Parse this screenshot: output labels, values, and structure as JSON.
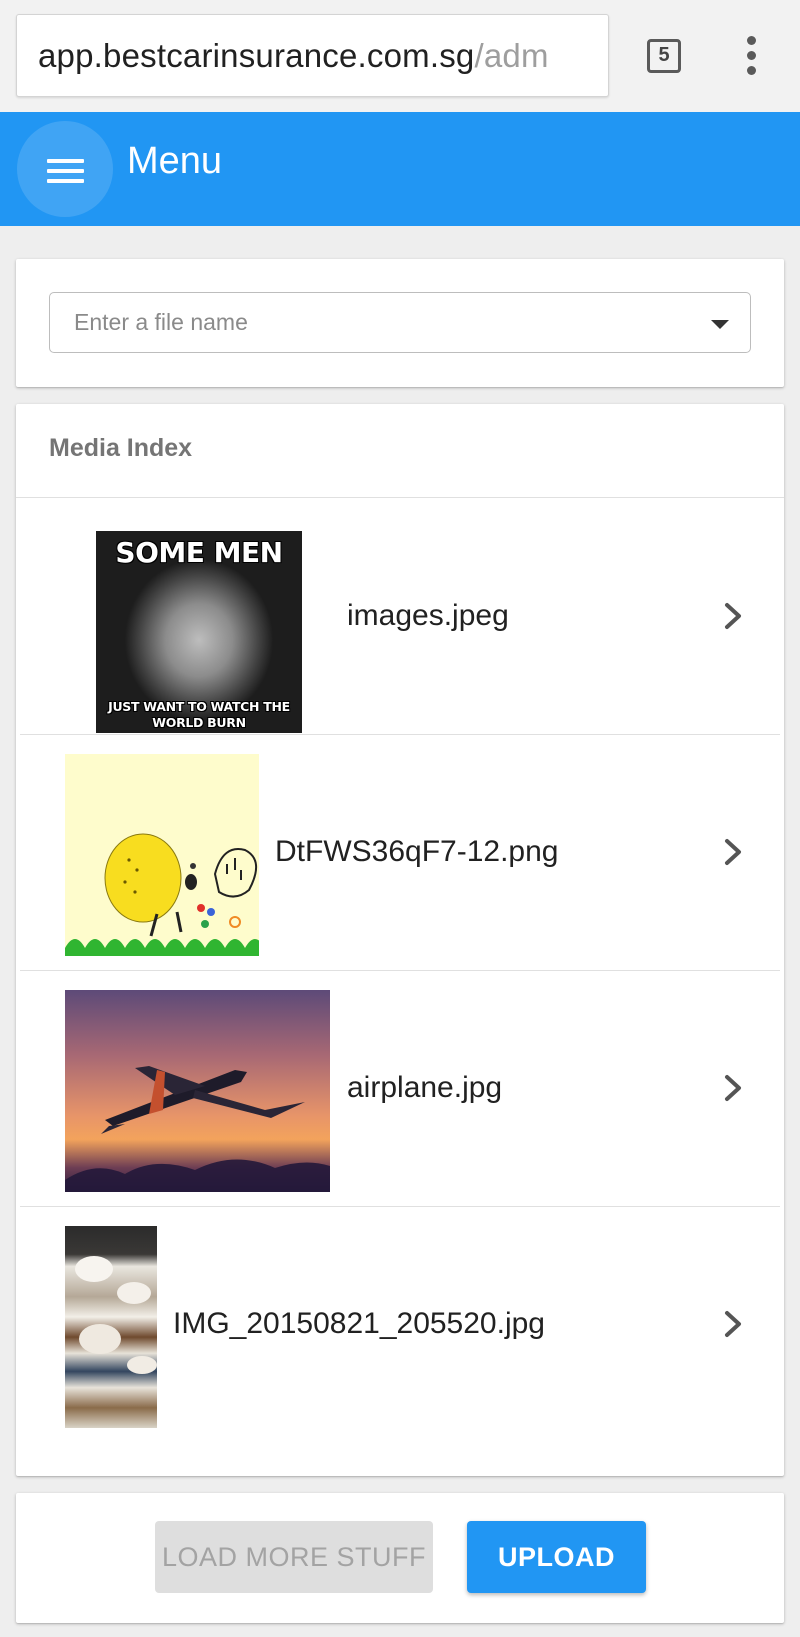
{
  "browser": {
    "url_host": "app.bestcarinsurance.com.sg",
    "url_path": "/adm",
    "tab_count": "5",
    "tabs_icon": "tab-switcher-icon",
    "overflow_icon": "more-vert-icon"
  },
  "appbar": {
    "menu_icon": "hamburger-menu-icon",
    "title": "Menu",
    "color": "#2196f3"
  },
  "search": {
    "placeholder": "Enter a file name",
    "value": "",
    "dropdown_icon": "arrow-drop-down-icon"
  },
  "media": {
    "heading": "Media Index",
    "items": [
      {
        "name": "images.jpeg",
        "thumb_caption_top": "SOME MEN",
        "thumb_caption_bottom": "JUST WANT TO WATCH THE WORLD BURN"
      },
      {
        "name": "DtFWS36qF7-12.png"
      },
      {
        "name": "airplane.jpg"
      },
      {
        "name": "IMG_20150821_205520.jpg"
      }
    ],
    "chevron_icon": "chevron-right-icon"
  },
  "actions": {
    "load_more_label": "LOAD MORE STUFF",
    "load_more_disabled": true,
    "upload_label": "UPLOAD",
    "accent": "#2196f3"
  }
}
